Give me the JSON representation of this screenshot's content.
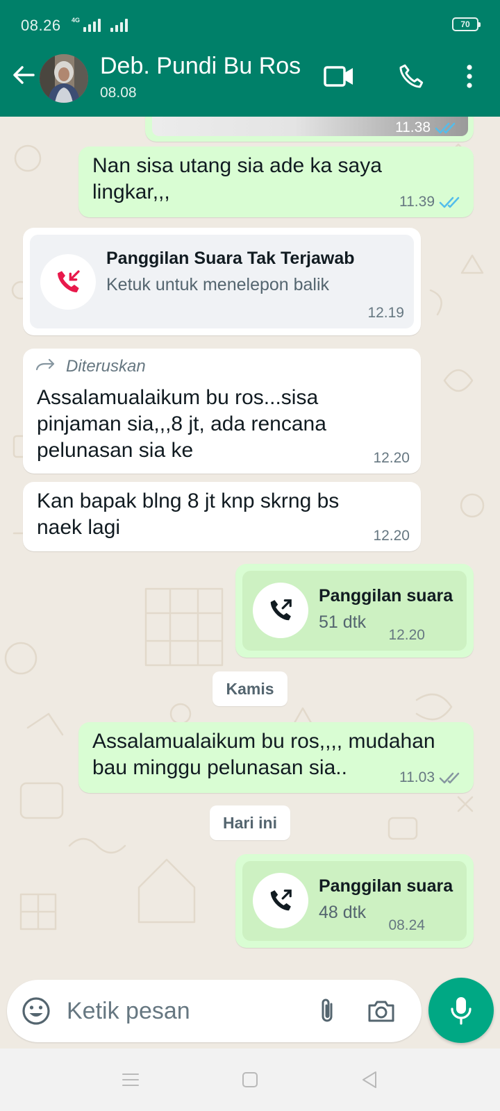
{
  "status_bar": {
    "time": "08.26",
    "network": "4G",
    "battery": "70"
  },
  "header": {
    "contact_name": "Deb. Pundi Bu Ros",
    "last_seen": "08.08",
    "icons": [
      "back-arrow-icon",
      "video-call-icon",
      "voice-call-icon",
      "more-options-icon"
    ]
  },
  "messages": [
    {
      "direction": "out",
      "type": "image",
      "time": "11.38",
      "status": "read"
    },
    {
      "direction": "out",
      "type": "text",
      "text": "Nan sisa utang sia ade ka saya lingkar,,,",
      "time": "11.39",
      "status": "read"
    },
    {
      "direction": "in",
      "type": "missed_call",
      "title": "Panggilan Suara Tak Terjawab",
      "subtitle": "Ketuk untuk menelepon balik",
      "time": "12.19"
    },
    {
      "direction": "in",
      "type": "text",
      "forwarded_label": "Diteruskan",
      "text": "Assalamualaikum bu ros...sisa pinjaman sia,,,8  jt, ada rencana pelunasan sia ke",
      "time": "12.20"
    },
    {
      "direction": "in",
      "type": "text",
      "text": "Kan bapak blng 8 jt knp skrng bs naek lagi",
      "time": "12.20"
    },
    {
      "direction": "out",
      "type": "call",
      "title": "Panggilan suara",
      "duration": "51 dtk",
      "time": "12.20"
    },
    {
      "direction": "out",
      "type": "text",
      "text": "Assalamualaikum bu ros,,,, mudahan bau minggu pelunasan sia..",
      "time": "11.03",
      "status": "delivered"
    },
    {
      "direction": "out",
      "type": "call",
      "title": "Panggilan suara",
      "duration": "48 dtk",
      "time": "08.24"
    }
  ],
  "date_chips": {
    "kamis": "Kamis",
    "hari_ini": "Hari ini"
  },
  "composer": {
    "placeholder": "Ketik pesan",
    "icons": [
      "emoji-icon",
      "attach-icon",
      "camera-icon",
      "mic-icon"
    ]
  },
  "colors": {
    "header": "#008069",
    "outgoing_bubble": "#d9fdd3",
    "incoming_bubble": "#ffffff",
    "chat_bg": "#efeae2",
    "read_tick": "#53bdeb",
    "missed_call": "#e8194b",
    "mic_button": "#00a884"
  }
}
